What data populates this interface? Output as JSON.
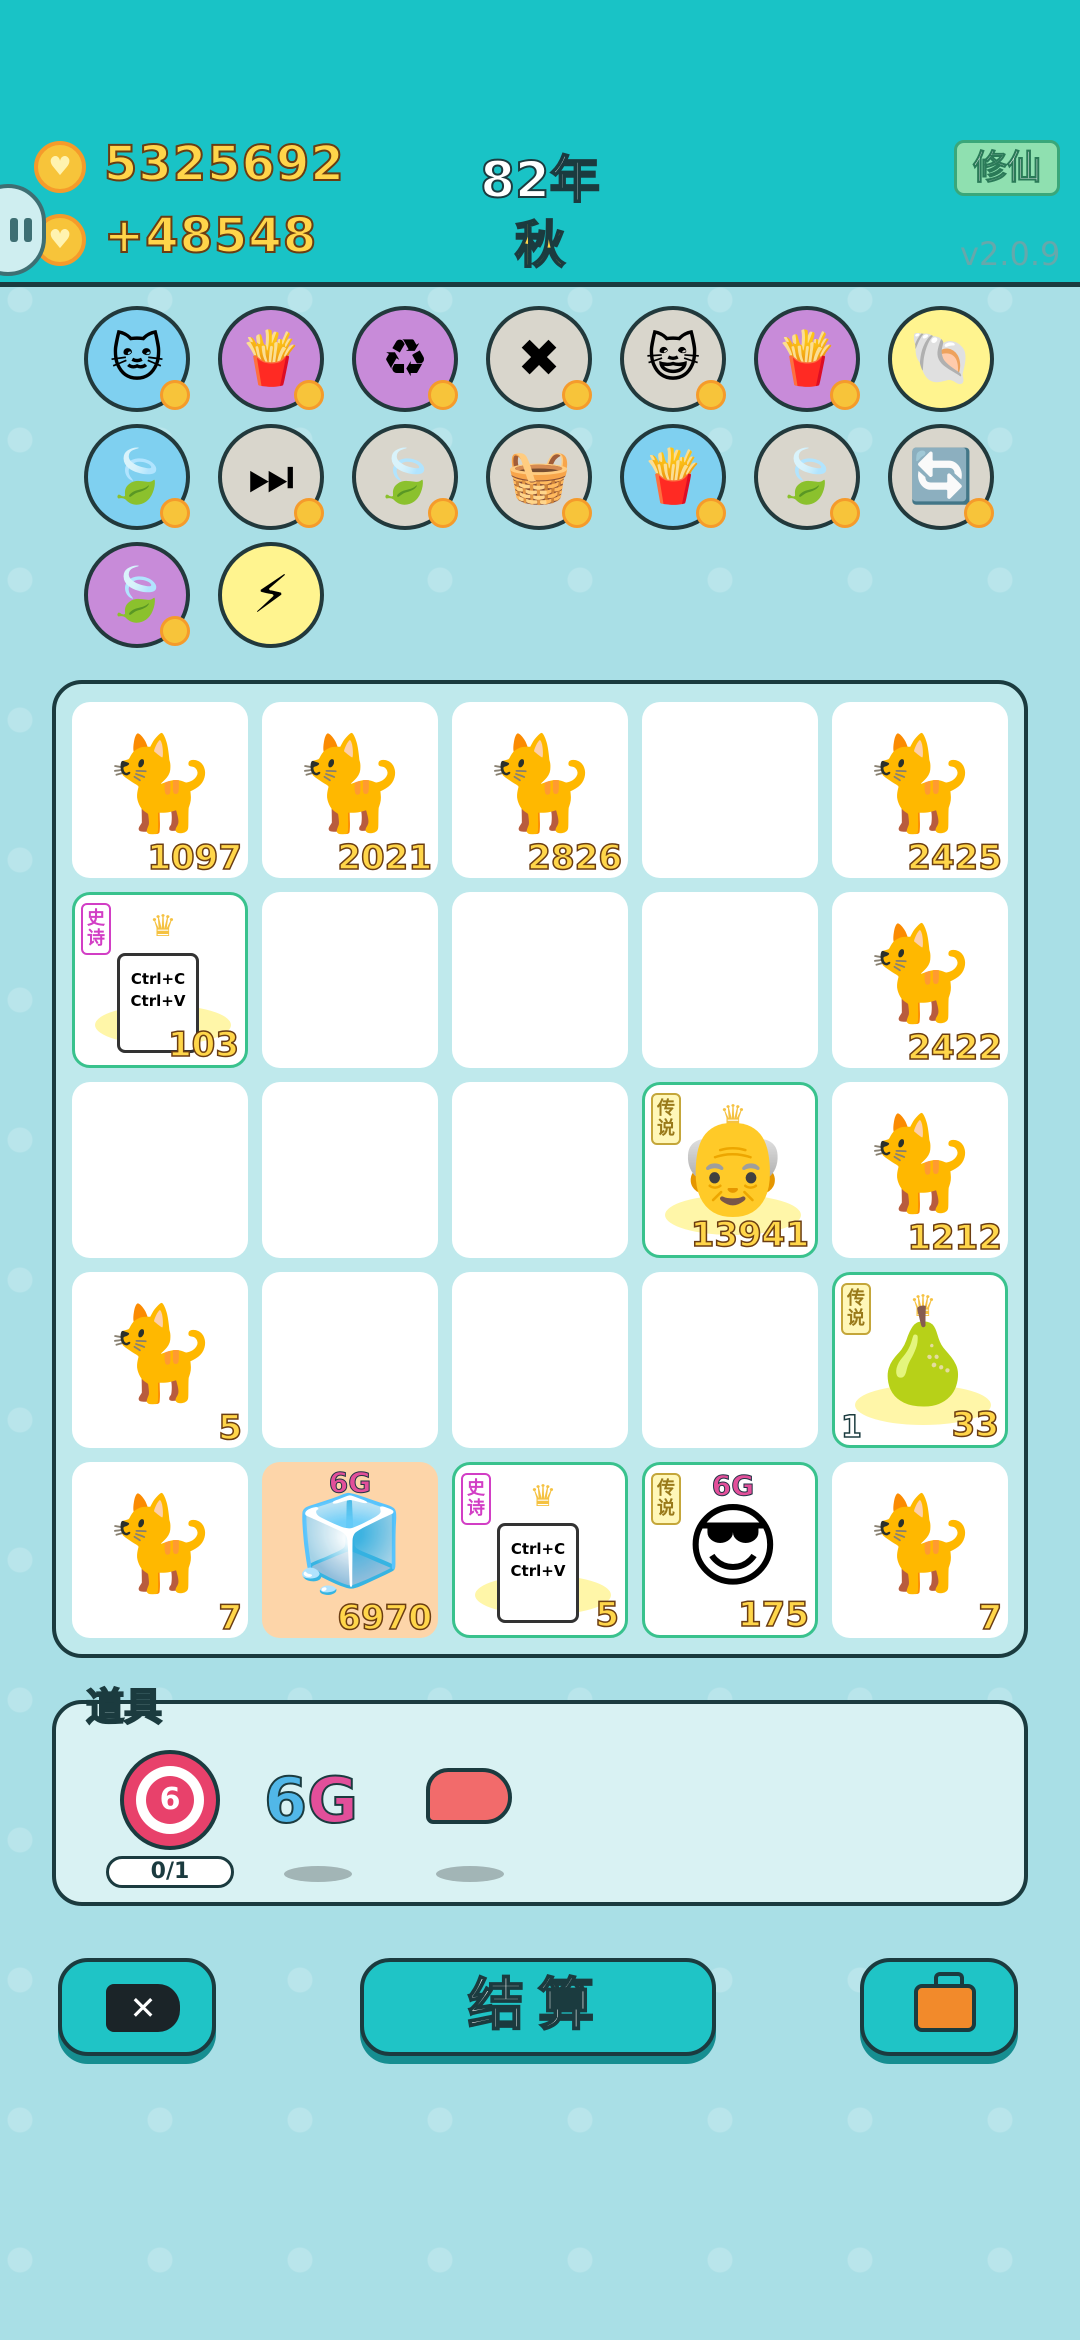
{
  "header": {
    "coins": "5325692",
    "income": "+48548",
    "year": "82年",
    "season": "秋",
    "cultivate_label": "修仙",
    "version": "v2.0.9"
  },
  "buffs": [
    {
      "icon": "cat-icon",
      "glyph": "🐱",
      "color": "blue"
    },
    {
      "icon": "fries-icon",
      "glyph": "🍟",
      "color": "purple"
    },
    {
      "icon": "recycle-icon",
      "glyph": "♻",
      "color": "purple"
    },
    {
      "icon": "close-tag-icon",
      "glyph": "✖",
      "color": "gray"
    },
    {
      "icon": "cat-duo-icon",
      "glyph": "😺",
      "color": "gray"
    },
    {
      "icon": "fries-icon",
      "glyph": "🍟",
      "color": "purple"
    },
    {
      "icon": "shell-icon",
      "glyph": "🐚",
      "color": "yellow"
    },
    {
      "icon": "leaf-icon",
      "glyph": "🍃",
      "color": "blue"
    },
    {
      "icon": "skip-icon",
      "glyph": "⏭",
      "color": "gray"
    },
    {
      "icon": "leaf-icon",
      "glyph": "🍃",
      "color": "gray"
    },
    {
      "icon": "fruit-basket-icon",
      "glyph": "🧺",
      "color": "gray"
    },
    {
      "icon": "fries-icon",
      "glyph": "🍟",
      "color": "blue"
    },
    {
      "icon": "leaf-icon",
      "glyph": "🍃",
      "color": "gray"
    },
    {
      "icon": "refresh-icon",
      "glyph": "🔄",
      "color": "gray"
    },
    {
      "icon": "leaf-icon",
      "glyph": "🍃",
      "color": "purple"
    },
    {
      "icon": "lightning-icon",
      "glyph": "⚡",
      "color": "yellow"
    }
  ],
  "board": [
    [
      {
        "type": "cat",
        "value": "1097"
      },
      {
        "type": "cat",
        "value": "2021"
      },
      {
        "type": "cat",
        "value": "2826"
      },
      {
        "type": "empty"
      },
      {
        "type": "cat",
        "value": "2425"
      }
    ],
    [
      {
        "type": "ctrl",
        "value": "103",
        "tag": "史诗",
        "ctrl_c": "Ctrl+C",
        "ctrl_v": "Ctrl+V"
      },
      {
        "type": "empty"
      },
      {
        "type": "empty"
      },
      {
        "type": "empty"
      },
      {
        "type": "cat",
        "value": "2422"
      }
    ],
    [
      {
        "type": "empty"
      },
      {
        "type": "empty"
      },
      {
        "type": "empty"
      },
      {
        "type": "elder",
        "value": "13941",
        "tag": "传说"
      },
      {
        "type": "cat",
        "value": "1212"
      }
    ],
    [
      {
        "type": "cat",
        "value": "5"
      },
      {
        "type": "empty"
      },
      {
        "type": "empty"
      },
      {
        "type": "empty"
      },
      {
        "type": "pear",
        "value": "33",
        "left": "1",
        "tag": "传说"
      }
    ],
    [
      {
        "type": "cat",
        "value": "7"
      },
      {
        "type": "fridge",
        "value": "6970",
        "label": "6G"
      },
      {
        "type": "ctrl",
        "value": "5",
        "tag": "史诗",
        "ctrl_c": "Ctrl+C",
        "ctrl_v": "Ctrl+V"
      },
      {
        "type": "cool",
        "value": "175",
        "tag": "传说",
        "label": "6G"
      },
      {
        "type": "cat",
        "value": "7"
      }
    ]
  ],
  "items": {
    "title": "道具",
    "target_count": "6",
    "target_progress": "0/1",
    "sixg_a": "6",
    "sixg_b": "G"
  },
  "buttons": {
    "settle": "结算"
  }
}
